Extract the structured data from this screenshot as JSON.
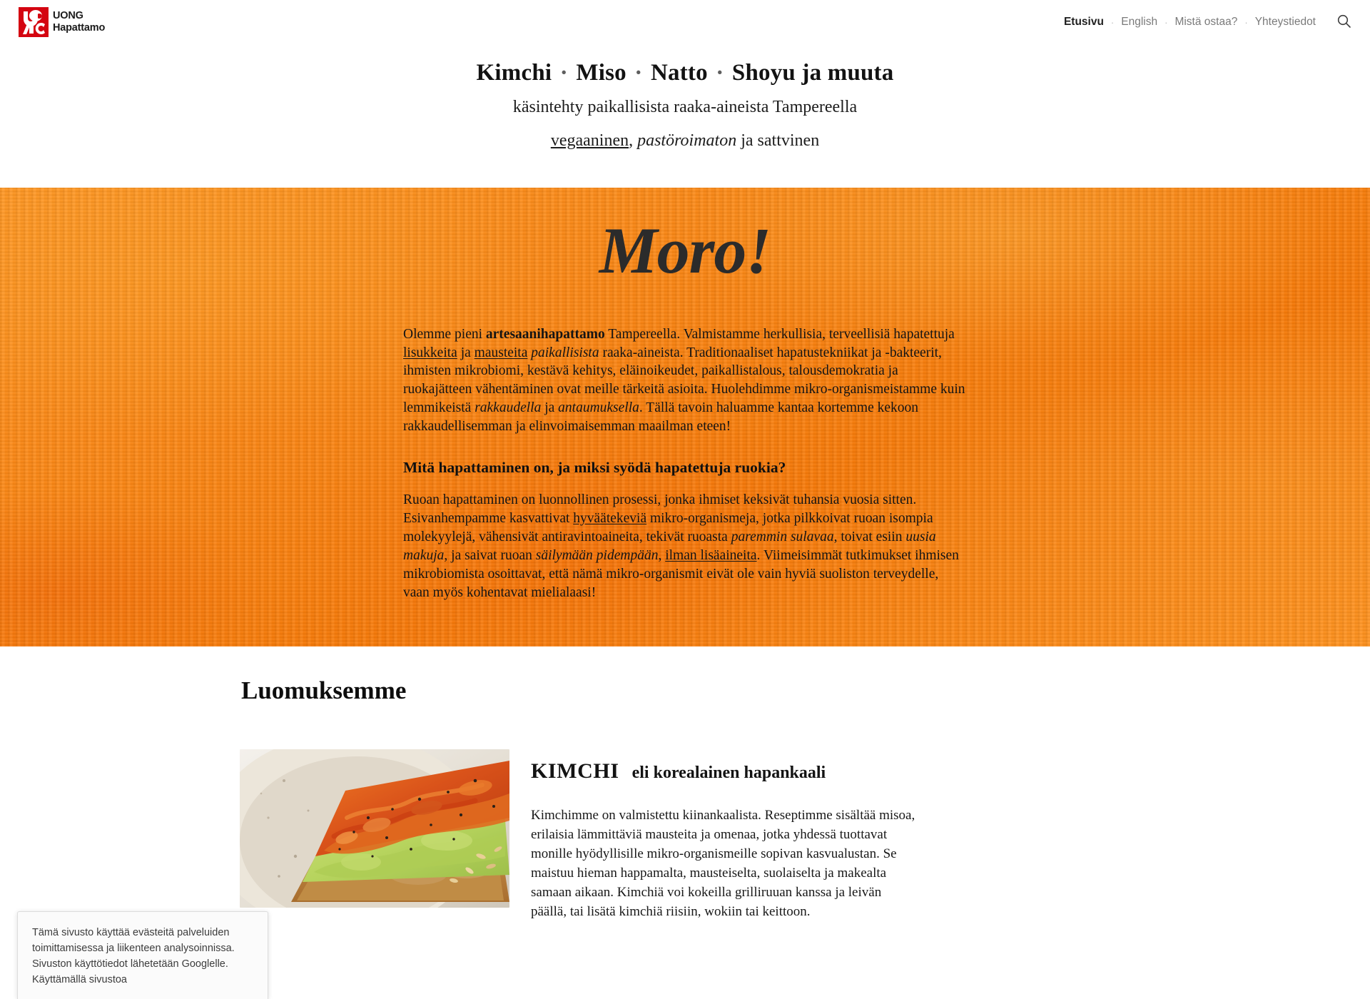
{
  "header": {
    "brand": {
      "line1": "UONG",
      "line2": "Hapattamo",
      "logo_icon": "uong-logo-icon",
      "logo_color": "#d40511"
    },
    "nav": [
      {
        "label": "Etusivu",
        "active": true
      },
      {
        "label": "English",
        "active": false
      },
      {
        "label": "Mistä ostaa?",
        "active": false
      },
      {
        "label": "Yhteystiedot",
        "active": false
      }
    ],
    "separator": "·",
    "search_icon": "search-icon"
  },
  "titles": {
    "main_parts": [
      "Kimchi",
      "Miso",
      "Natto",
      "Shoyu ja muuta"
    ],
    "main_separator": "·",
    "subtitle": "käsintehty paikallisista raaka-aineista Tampereella",
    "tagline_link": "vegaaninen",
    "tagline_comma": ", ",
    "tagline_italic": "pastöroimaton",
    "tagline_rest": " ja sattvinen"
  },
  "hero": {
    "moro": "Moro!",
    "background_color": "#ff8a15",
    "intro": {
      "p1_a": "Olemme pieni ",
      "p1_bold": "artesaanihapattamo",
      "p1_b": " Tampereella. Valmistamme herkullisia, terveellisiä hapatettuja ",
      "p1_link1": "lisukkeita",
      "p1_c": " ja ",
      "p1_link2": "mausteita",
      "p1_d": " ",
      "p1_italic1": "paikallisista",
      "p1_e": " raaka-aineista. Traditionaaliset hapatustekniikat ja -bakteerit, ihmisten mikrobiomi, kestävä kehitys, eläinoikeudet, paikallistalous, talousdemokratia ja ruokajätteen vähentäminen ovat meille tärkeitä asioita. Huolehdimme mikro-organismeistamme kuin lemmikeistä ",
      "p1_italic2": "rakkaudella",
      "p1_f": " ja ",
      "p1_italic3": "antaumuksella",
      "p1_g": ". Tällä tavoin haluamme kantaa kortemme kekoon rakkaudellisemman ja elinvoimaisemman maailman eteen!"
    },
    "h2": "Mitä hapattaminen on, ja miksi syödä hapatettuja ruokia?",
    "explain": {
      "p2_a": "Ruoan hapattaminen on luonnollinen prosessi, jonka ihmiset keksivät tuhansia vuosia sitten. Esivanhempamme kasvattivat ",
      "p2_link1": "hyväätekeviä",
      "p2_b": " mikro-organismeja, jotka pilkkoivat ruoan isompia molekyylejä, vähensivät antiravintoaineita, tekivät ruoasta ",
      "p2_italic1": "paremmin sulavaa",
      "p2_c": ", toivat esiin ",
      "p2_italic2": "uusia makuja",
      "p2_d": ", ja saivat ruoan ",
      "p2_italic3": "säilymään pidempään",
      "p2_e": ", ",
      "p2_link2": "ilman lisäaineita",
      "p2_f": ". Viimeisimmät tutkimukset ihmisen mikrobiomista osoittavat, että nämä mikro-organismit eivät ole vain hyviä suoliston terveydelle, vaan myös kohentavat mielialaasi!"
    }
  },
  "products": {
    "section_title": "Luomuksemme",
    "items": [
      {
        "name": "KIMCHI",
        "description_suffix": "eli korealainen hapankaali",
        "photo_alt": "kimchi-avocado-toast-photo",
        "body": "Kimchimme on valmistettu kiinankaalista. Reseptimme sisältää misoa, erilaisia lämmittäviä mausteita ja omenaa, jotka yhdessä tuottavat monille hyödyllisille mikro-organismeille sopivan kasvualustan. Se maistuu hieman happamalta, mausteiselta, suolaiselta ja makealta samaan aikaan. Kimchiä voi kokeilla grilliruuan kanssa ja leivän päällä, tai lisätä kimchiä riisiin, wokiin tai keittoon."
      }
    ]
  },
  "cookie_banner": {
    "text": "Tämä sivusto käyttää evästeitä palveluiden toimittamisessa ja liikenteen analysoinnissa. Sivuston käyttötiedot lähetetään Googlelle. Käyttämällä sivustoa"
  }
}
